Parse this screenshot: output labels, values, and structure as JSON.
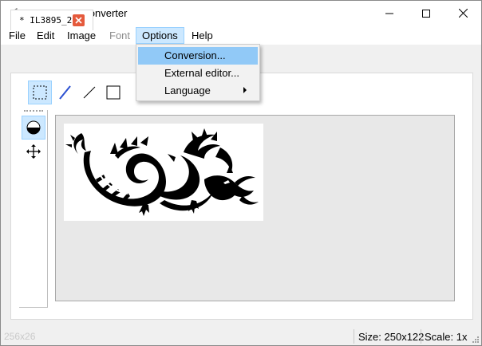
{
  "window": {
    "title": "LCD Image Converter",
    "controls": {
      "minimize": "minimize",
      "maximize": "maximize",
      "close": "close"
    }
  },
  "menubar": {
    "items": [
      {
        "label": "File",
        "state": "normal"
      },
      {
        "label": "Edit",
        "state": "normal"
      },
      {
        "label": "Image",
        "state": "normal"
      },
      {
        "label": "Font",
        "state": "disabled"
      },
      {
        "label": "Options",
        "state": "open"
      },
      {
        "label": "Help",
        "state": "normal"
      }
    ]
  },
  "options_menu": {
    "items": [
      {
        "label": "Conversion...",
        "highlighted": true,
        "submenu": false
      },
      {
        "label": "External editor...",
        "highlighted": false,
        "submenu": false
      },
      {
        "label": "Language",
        "highlighted": false,
        "submenu": true
      }
    ]
  },
  "document_tab": {
    "label": "* IL3895_2",
    "close_icon": "close-icon"
  },
  "toolbar": {
    "tools": [
      {
        "icon": "rectangle-select-icon",
        "selected": true
      },
      {
        "icon": "pen-icon",
        "selected": false
      },
      {
        "icon": "line-icon",
        "selected": false
      },
      {
        "icon": "rectangle-icon",
        "selected": false
      }
    ]
  },
  "side_palette": {
    "tools": [
      {
        "icon": "fill-mode-icon",
        "selected": true
      },
      {
        "icon": "move-icon",
        "selected": false
      }
    ]
  },
  "canvas": {
    "image_name": "dragon-image"
  },
  "statusbar": {
    "coords": "256x26",
    "size_text": "Size: 250x122",
    "scale_text": "Scale: 1x"
  },
  "colors": {
    "menu_highlight": "#cce8ff",
    "dropdown_highlight": "#91c9f7",
    "close_tab": "#e55a3c"
  }
}
